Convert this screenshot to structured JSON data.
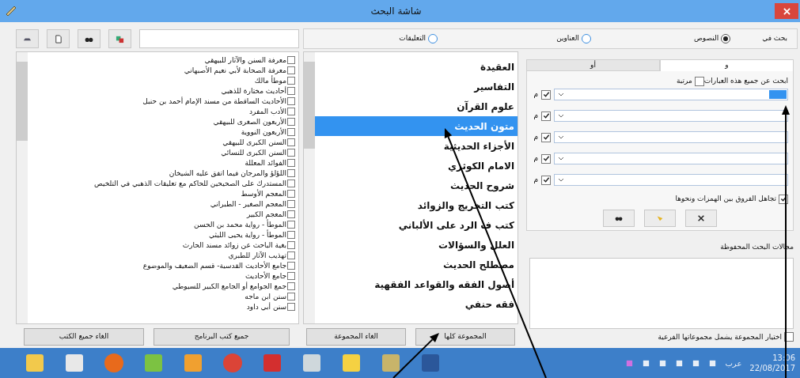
{
  "window": {
    "title": "شاشة البحث"
  },
  "search_in": {
    "label": "بحث في",
    "options": [
      {
        "label": "النصوص",
        "selected": true
      },
      {
        "label": "العناوين",
        "selected": false
      },
      {
        "label": "التعليقات",
        "selected": false
      }
    ]
  },
  "books": [
    {
      "label": "معرفة السنن والآثار للبيهقي",
      "checked": false
    },
    {
      "label": "معرفة الصحابة لأبي نعيم الأصبهاني",
      "checked": false
    },
    {
      "label": "موطأ مالك",
      "checked": false
    },
    {
      "label": "أحاديث مختارة للذهبي",
      "checked": false
    },
    {
      "label": "الأحاديث الساقطة من مسند الإمام أحمد بن حنبل",
      "checked": false
    },
    {
      "label": "الأدب المفرد",
      "checked": false
    },
    {
      "label": "الأربعون الصغرى للبيهقي",
      "checked": false
    },
    {
      "label": "الأربعون النووية",
      "checked": false
    },
    {
      "label": "السنن الكبرى للبيهقي",
      "checked": false
    },
    {
      "label": "السنن الكبرى للنسائي",
      "checked": false
    },
    {
      "label": "الفوائد المعللة",
      "checked": false
    },
    {
      "label": "اللؤلؤ والمرجان فيما اتفق عليه الشيخان",
      "checked": false
    },
    {
      "label": "المستدرك على الصحيحين للحاكم مع تعليقات الذهبي في التلخيص",
      "checked": false
    },
    {
      "label": "المعجم الأوسط",
      "checked": false
    },
    {
      "label": "المعجم الصغير - الطبراني",
      "checked": false
    },
    {
      "label": "المعجم الكبير",
      "checked": false
    },
    {
      "label": "الموطأ - رواية محمد بن الحسن",
      "checked": false
    },
    {
      "label": "الموطأ - رواية يحيى الليثي",
      "checked": false
    },
    {
      "label": "بغية الباحث عن زوائد مسند الحارث",
      "checked": false
    },
    {
      "label": "تهذيب الآثار للطبري",
      "checked": false
    },
    {
      "label": "جامع الأحاديث القدسية- قسم الضعيف والموضوع",
      "checked": false
    },
    {
      "label": "جامع الأحاديث",
      "checked": false
    },
    {
      "label": "جمع الجوامع أو الجامع الكبير للسيوطي",
      "checked": false
    },
    {
      "label": "سنن ابن ماجه",
      "checked": false
    },
    {
      "label": "سنن أبي داود",
      "checked": false
    }
  ],
  "book_buttons": [
    "جميع كتب البرنامج",
    "الغاء جميع الكتب"
  ],
  "categories": [
    {
      "label": "العقيدة",
      "selected": false
    },
    {
      "label": "التفاسير",
      "selected": false
    },
    {
      "label": "علوم القرآن",
      "selected": false
    },
    {
      "label": "متون الحديث",
      "selected": true
    },
    {
      "label": "الأجزاء الحديثية",
      "selected": false
    },
    {
      "label": "الامام الكوثري",
      "selected": false
    },
    {
      "label": "شروح الحديث",
      "selected": false
    },
    {
      "label": "كتب التخريج والزوائد",
      "selected": false
    },
    {
      "label": "كتب ف الرد على الألباني",
      "selected": false
    },
    {
      "label": "العلل والسؤالات",
      "selected": false
    },
    {
      "label": "مصطلح الحديث",
      "selected": false
    },
    {
      "label": "أصول الفقه والقواعد الفقهية",
      "selected": false
    },
    {
      "label": "فقه حنفي",
      "selected": false
    }
  ],
  "category_buttons": [
    "المجموعة كلها",
    "الغاء المجموعة"
  ],
  "tabs": [
    {
      "label": "و",
      "selected": true
    },
    {
      "label": "أو",
      "selected": false
    }
  ],
  "phrases": {
    "label": "ابحث عن جميع هذه العبارات",
    "ordered": {
      "label": "مرتبة",
      "checked": false
    },
    "fields": [
      {
        "has_selection": true,
        "checked": true,
        "mark": "م"
      },
      {
        "has_selection": false,
        "checked": true,
        "mark": "م"
      },
      {
        "has_selection": false,
        "checked": true,
        "mark": "م"
      },
      {
        "has_selection": false,
        "checked": true,
        "mark": "م"
      },
      {
        "has_selection": false,
        "checked": true,
        "mark": "م"
      }
    ]
  },
  "ignore_hamza": {
    "label": "تجاهل الفروق بين الهمزات ونحوها",
    "checked": true
  },
  "saved": {
    "label": "مجالات البحث المحفوظة"
  },
  "include_sub": {
    "label": "اختيار المجموعة يشمل مجموعاتها الفرعية",
    "checked": false
  },
  "taskbar": {
    "language": "عرب",
    "time": "13:06",
    "date": "22/08/2017"
  }
}
